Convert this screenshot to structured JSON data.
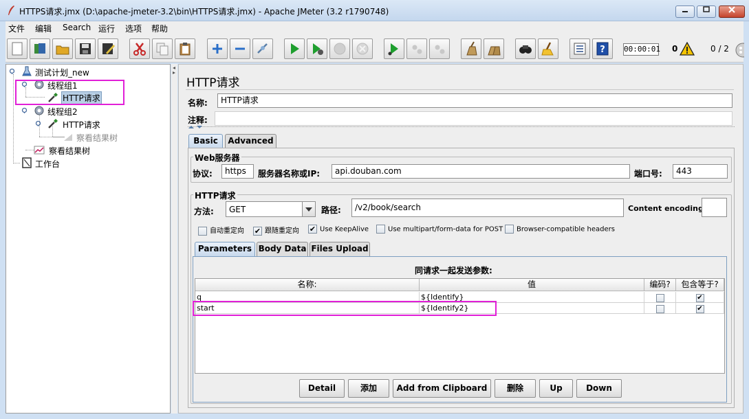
{
  "window": {
    "title": "HTTPS请求.jmx (D:\\apache-jmeter-3.2\\bin\\HTTPS请求.jmx) - Apache JMeter (3.2 r1790748)"
  },
  "menu": [
    "文件",
    "编辑",
    "Search",
    "运行",
    "选项",
    "帮助"
  ],
  "toolbar": {
    "icons": [
      "new-icon",
      "templates-icon",
      "open-icon",
      "save-icon",
      "save-as-icon",
      "cut-icon",
      "copy-icon",
      "paste-icon",
      "expand-icon",
      "collapse-icon",
      "toggle-icon",
      "start-icon",
      "start-no-pause-icon",
      "stop-icon",
      "shutdown-icon",
      "remote-start-icon",
      "remote-stop-icon",
      "remote-shutdown-icon",
      "clear-icon",
      "clear-all-icon",
      "search-icon",
      "reset-search-icon",
      "function-helper-icon",
      "help-icon"
    ],
    "elapsed_time": "00:00:01",
    "error_count": "0",
    "thread_count": "0 / 2"
  },
  "tree": {
    "test_plan": "测试计划_new",
    "thread_group_1": "线程组1",
    "http_request_1": "HTTP请求",
    "thread_group_2": "线程组2",
    "http_request_2": "HTTP请求",
    "result_tree_disabled": "察看结果树",
    "result_tree": "察看结果树",
    "workbench": "工作台"
  },
  "sampler": {
    "title": "HTTP请求",
    "name_label": "名称:",
    "name_value": "HTTP请求",
    "comment_label": "注释:",
    "comment_value": "",
    "tabs": [
      "Basic",
      "Advanced"
    ],
    "web_server": {
      "group_title": "Web服务器",
      "protocol_label": "协议:",
      "protocol_value": "https",
      "server_label": "服务器名称或IP:",
      "server_value": "api.douban.com",
      "port_label": "端口号:",
      "port_value": "443"
    },
    "http_request": {
      "group_title": "HTTP请求",
      "method_label": "方法:",
      "method_value": "GET",
      "path_label": "路径:",
      "path_value": "/v2/book/search",
      "encoding_label": "Content encoding:",
      "encoding_value": "",
      "checkboxes": [
        {
          "label": "自动重定向",
          "checked": false
        },
        {
          "label": "跟随重定向",
          "checked": true
        },
        {
          "label": "Use KeepAlive",
          "checked": true
        },
        {
          "label": "Use multipart/form-data for POST",
          "checked": false
        },
        {
          "label": "Browser-compatible headers",
          "checked": false
        }
      ]
    },
    "param_tabs": [
      "Parameters",
      "Body Data",
      "Files Upload"
    ],
    "params": {
      "caption": "同请求一起发送参数:",
      "columns": [
        "名称:",
        "值",
        "编码?",
        "包含等于?"
      ],
      "rows": [
        {
          "name": "q",
          "value": "${Identify}",
          "encode": false,
          "include_equals": true
        },
        {
          "name": "start",
          "value": "${Identify2}",
          "encode": false,
          "include_equals": true
        }
      ]
    },
    "buttons": [
      "Detail",
      "添加",
      "Add from Clipboard",
      "删除",
      "Up",
      "Down"
    ]
  },
  "colors": {
    "highlight": "#e11fd7",
    "selection": "#b8cfe5",
    "tab_active": "#c8d9ed"
  }
}
